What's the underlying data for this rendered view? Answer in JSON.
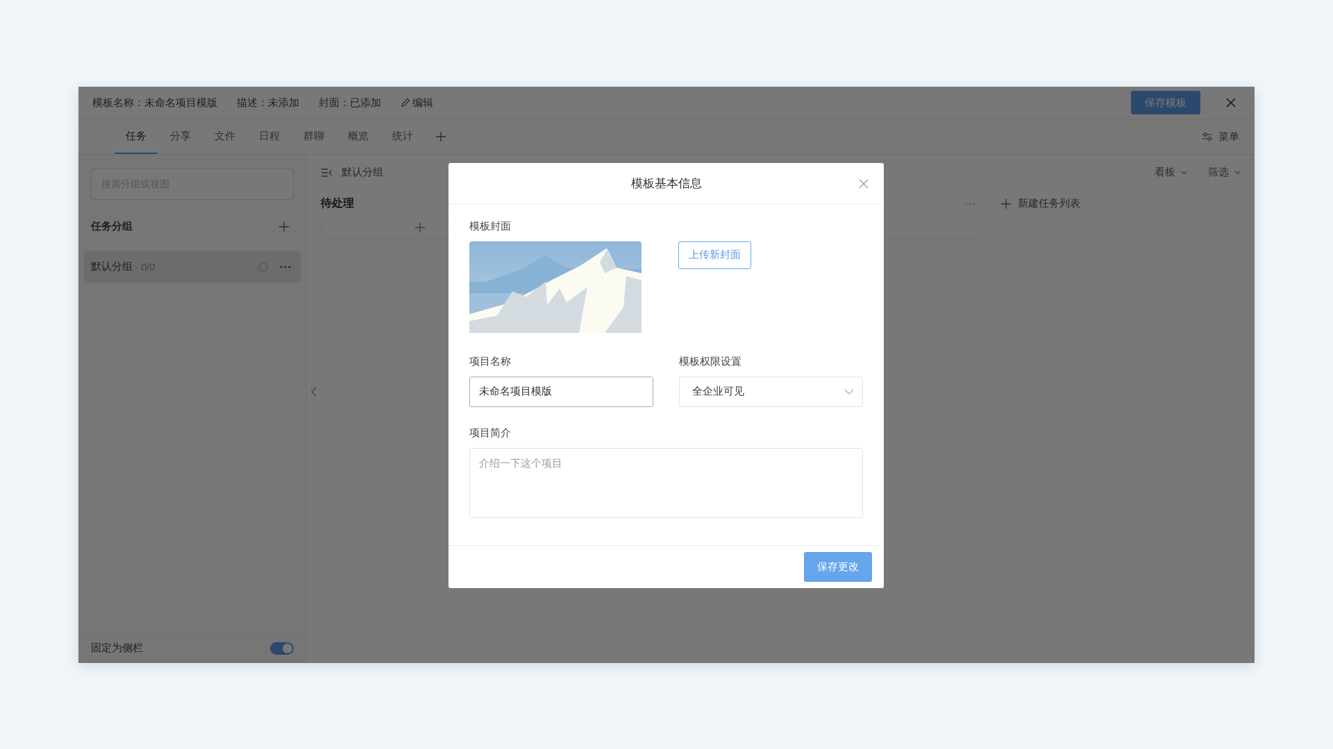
{
  "header": {
    "fields": [
      {
        "label": "模板名称：",
        "value": "未命名项目模版"
      },
      {
        "label": "描述：",
        "value": "未添加"
      },
      {
        "label": "封面：",
        "value": "已添加"
      }
    ],
    "edit_link": "编辑",
    "save_button": "保存模板"
  },
  "tabs": [
    {
      "label": "任务",
      "selected": true
    },
    {
      "label": "分享",
      "selected": false
    },
    {
      "label": "文件",
      "selected": false
    },
    {
      "label": "日程",
      "selected": false
    },
    {
      "label": "群聊",
      "selected": false
    },
    {
      "label": "概览",
      "selected": false
    },
    {
      "label": "统计",
      "selected": false
    }
  ],
  "menu_button": "菜单",
  "sidebar": {
    "search": {
      "placeholder": "搜索分组或视图"
    },
    "section_title": "任务分组",
    "groups": [
      {
        "name": "默认分组",
        "count": "· 0/0"
      }
    ],
    "pin_toggle": {
      "label": "固定为侧栏",
      "on": true
    }
  },
  "board": {
    "breadcrumb": "默认分组",
    "view_options": [
      "看板",
      "筛选"
    ],
    "columns": [
      {
        "title": "待处理"
      }
    ],
    "new_list": "新建任务列表"
  },
  "modal": {
    "title": "模板基本信息",
    "cover_label": "模板封面",
    "upload_button": "上传新封面",
    "name_label": "项目名称",
    "name_value": "未命名项目模版",
    "permission_label": "模板权限设置",
    "permission_value": "全企业可见",
    "intro_label": "项目简介",
    "intro_placeholder": "介绍一下这个项目",
    "save_button": "保存更改"
  }
}
